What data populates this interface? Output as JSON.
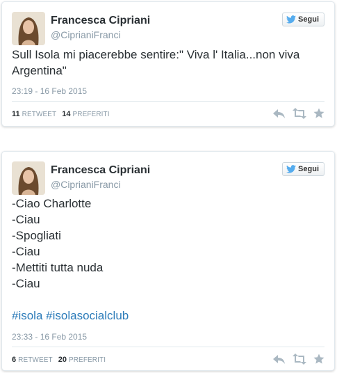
{
  "colors": {
    "text": "#292f33",
    "muted": "#8899a6",
    "link": "#2b7bb9",
    "border": "#e1e8ed",
    "twitter_blue": "#55acee",
    "action_icon": "#aab8c2"
  },
  "tweets": [
    {
      "author_name": "Francesca Cipriani",
      "author_handle": "@CiprianiFranci",
      "follow_label": "Segui",
      "follow_icon": "twitter-bird-icon",
      "lines": [
        "Sull Isola mi piacerebbe sentire:\" Viva l' Italia...non viva",
        "Argentina\""
      ],
      "hashtags": [],
      "timestamp": "23:19 - 16 Feb 2015",
      "retweet_count": "11",
      "retweet_label": "RETWEET",
      "favorite_count": "14",
      "favorite_label": "PREFERITI",
      "actions": [
        "reply-icon",
        "retweet-icon",
        "favorite-icon"
      ]
    },
    {
      "author_name": "Francesca Cipriani",
      "author_handle": "@CiprianiFranci",
      "follow_label": "Segui",
      "follow_icon": "twitter-bird-icon",
      "lines": [
        "-Ciao Charlotte",
        "-Ciau",
        "-Spogliati",
        "-Ciau",
        "-Mettiti tutta nuda",
        "-Ciau"
      ],
      "hashtags": [
        "#isola",
        "#isolasocialclub"
      ],
      "timestamp": "23:33 - 16 Feb 2015",
      "retweet_count": "6",
      "retweet_label": "RETWEET",
      "favorite_count": "20",
      "favorite_label": "PREFERITI",
      "actions": [
        "reply-icon",
        "retweet-icon",
        "favorite-icon"
      ]
    }
  ]
}
